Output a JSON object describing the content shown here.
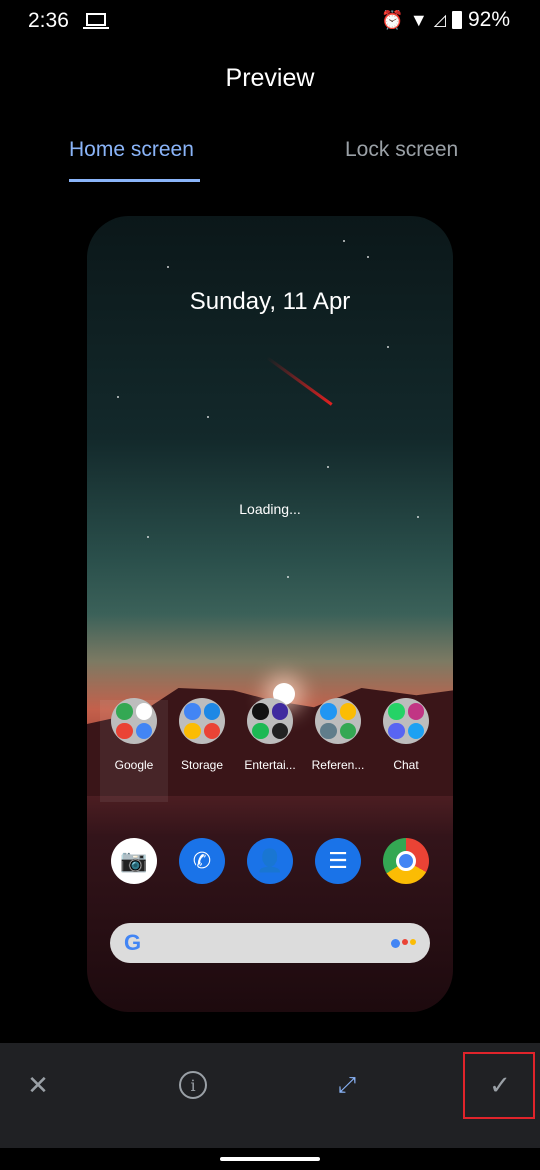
{
  "status_bar": {
    "time": "2:36",
    "battery": "92%",
    "icons": [
      "laptop-icon",
      "alarm-icon",
      "wifi-icon",
      "signal-off-icon",
      "battery-icon"
    ]
  },
  "header": {
    "title": "Preview"
  },
  "tabs": [
    {
      "label": "Home screen",
      "active": true
    },
    {
      "label": "Lock screen",
      "active": false
    }
  ],
  "preview": {
    "date": "Sunday, 11 Apr",
    "loading": "Loading...",
    "folders": [
      {
        "label": "Google"
      },
      {
        "label": "Storage"
      },
      {
        "label": "Entertai..."
      },
      {
        "label": "Referen..."
      },
      {
        "label": "Chat"
      }
    ],
    "dock": [
      "camera-go-icon",
      "phone-icon",
      "contacts-icon",
      "messages-icon",
      "chrome-icon"
    ],
    "search_logo": "G"
  },
  "toolbar": {
    "buttons": [
      "close-icon",
      "info-icon",
      "fullscreen-icon",
      "check-icon"
    ],
    "highlight_color": "#e0242b"
  },
  "colors": {
    "accent": "#8ab4f8",
    "toolbar_bg": "#202124"
  }
}
